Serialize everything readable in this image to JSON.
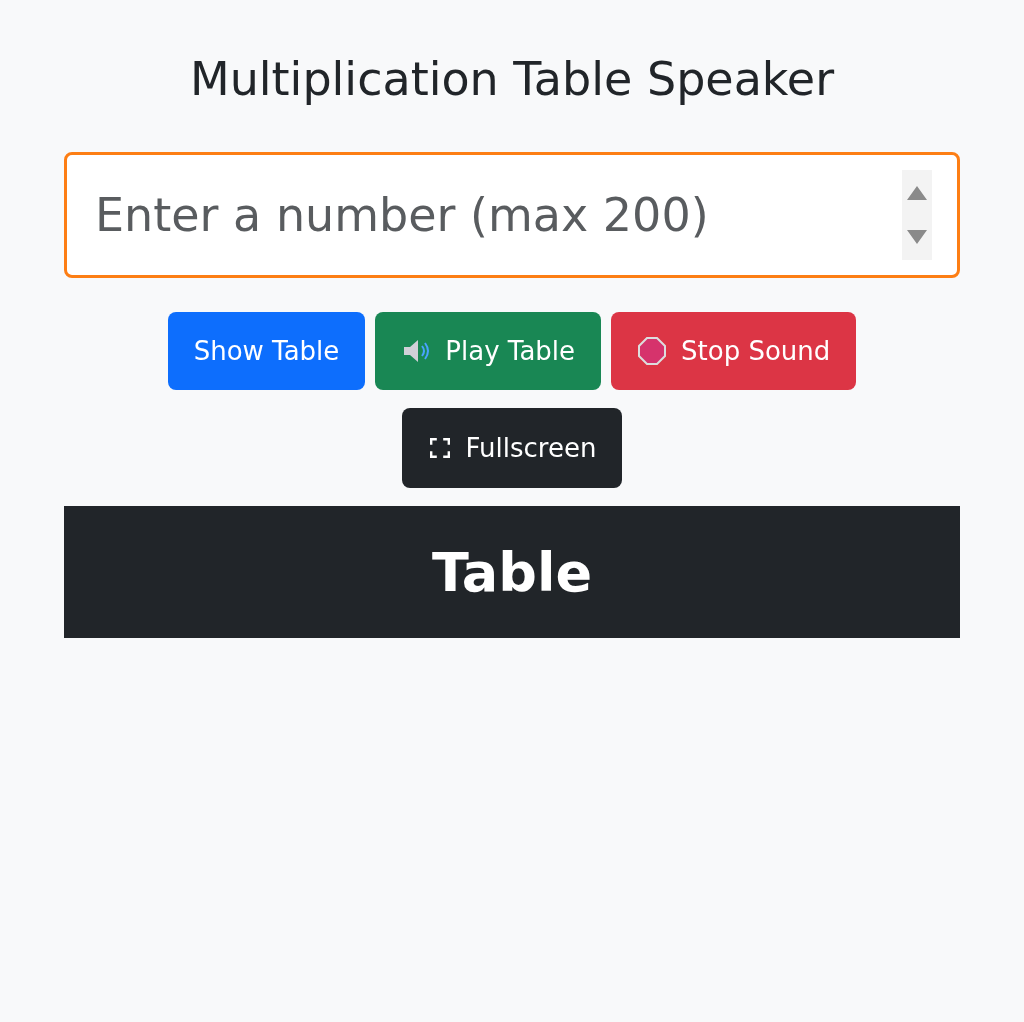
{
  "title": "Multiplication Table Speaker",
  "number_field": {
    "placeholder": "Enter a number (max 200)",
    "focused": true
  },
  "buttons": [
    {
      "label": "Show Table",
      "kind": "primary"
    },
    {
      "label": "Play Table",
      "kind": "success"
    },
    {
      "label": "Stop Sound",
      "kind": "danger"
    },
    {
      "label": "Fullscreen",
      "kind": "dark"
    }
  ],
  "table_header": "Table"
}
